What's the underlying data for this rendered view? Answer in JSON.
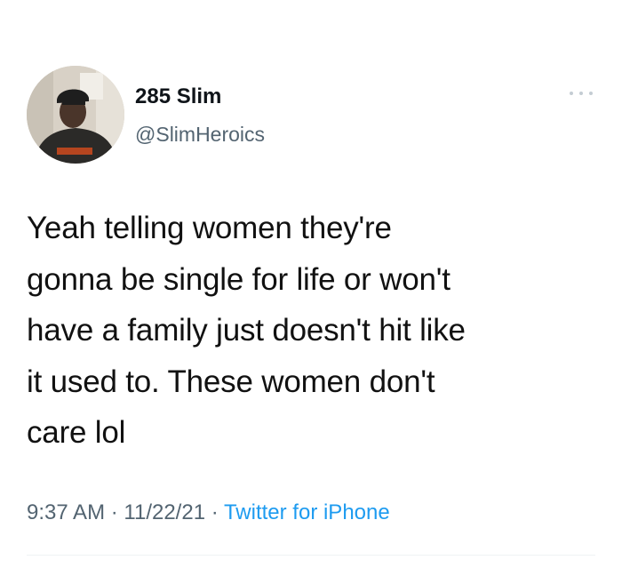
{
  "tweet": {
    "display_name": "285 Slim",
    "handle": "@SlimHeroics",
    "body_lines": [
      "Yeah telling women they're",
      "gonna be single for life or won't",
      "have a family just doesn't hit like",
      "it used to. These women don't",
      "care lol"
    ],
    "time": "9:37 AM",
    "separator": "·",
    "date": "11/22/21",
    "source": "Twitter for iPhone"
  },
  "icons": {
    "more": "more-horizontal-icon",
    "avatar": "profile-photo"
  },
  "colors": {
    "text": "#0f1419",
    "secondary": "#536471",
    "link": "#1d9bf0"
  }
}
